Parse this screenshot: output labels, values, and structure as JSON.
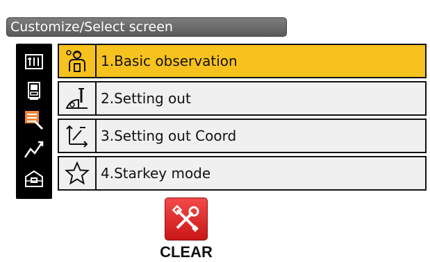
{
  "header": {
    "title": "Customize/Select screen"
  },
  "side_tabs": [
    {
      "icon": "ribbon-tab-icon"
    },
    {
      "icon": "instrument-tab-icon"
    },
    {
      "icon": "document-edit-tab-icon"
    },
    {
      "icon": "graph-tab-icon"
    },
    {
      "icon": "toolbox-tab-icon"
    }
  ],
  "menu": {
    "items": [
      {
        "label": "1.Basic observation",
        "icon": "surveyor-person-icon",
        "selected": true
      },
      {
        "label": "2.Setting out",
        "icon": "setting-out-stake-icon",
        "selected": false
      },
      {
        "label": "3.Setting out Coord",
        "icon": "coordinate-axes-icon",
        "selected": false
      },
      {
        "label": "4.Starkey mode",
        "icon": "star-icon",
        "selected": false
      }
    ]
  },
  "actions": {
    "clear_label": "CLEAR"
  },
  "colors": {
    "selected": "#f7c21d",
    "clear_button": "#e02a2a",
    "title_bar": "#6b6b6b"
  }
}
